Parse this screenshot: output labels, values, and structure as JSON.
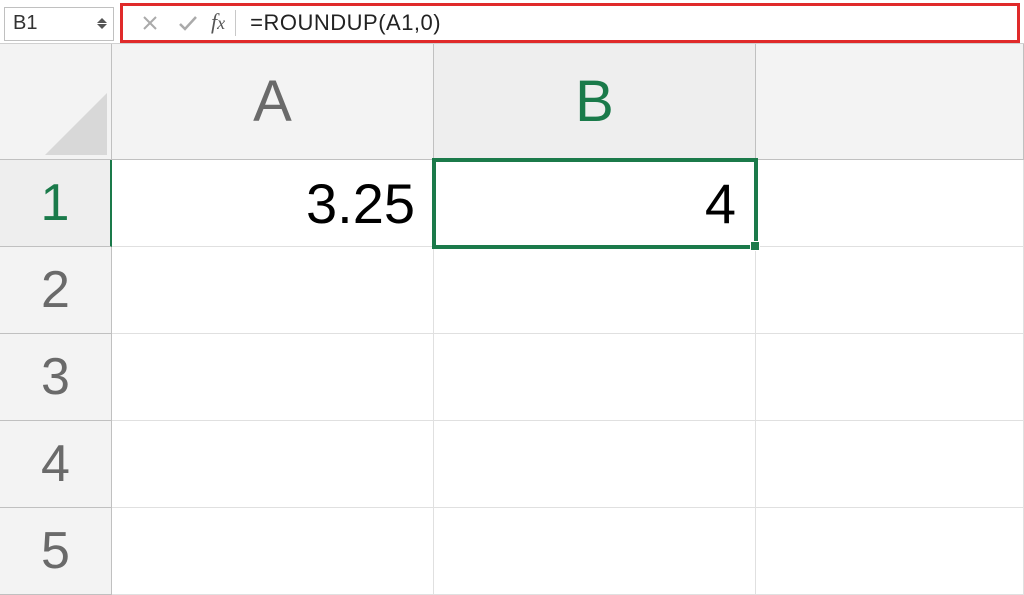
{
  "formulaBar": {
    "nameBox": "B1",
    "fxLabel": "fx",
    "formula": "=ROUNDUP(A1,0)"
  },
  "columns": [
    "A",
    "B"
  ],
  "rows": [
    "1",
    "2",
    "3",
    "4",
    "5"
  ],
  "selected": {
    "col": "B",
    "row": "1",
    "cellRef": "B1"
  },
  "cells": {
    "A1": "3.25",
    "B1": "4",
    "A2": "",
    "B2": "",
    "A3": "",
    "B3": "",
    "A4": "",
    "B4": "",
    "A5": "",
    "B5": ""
  }
}
